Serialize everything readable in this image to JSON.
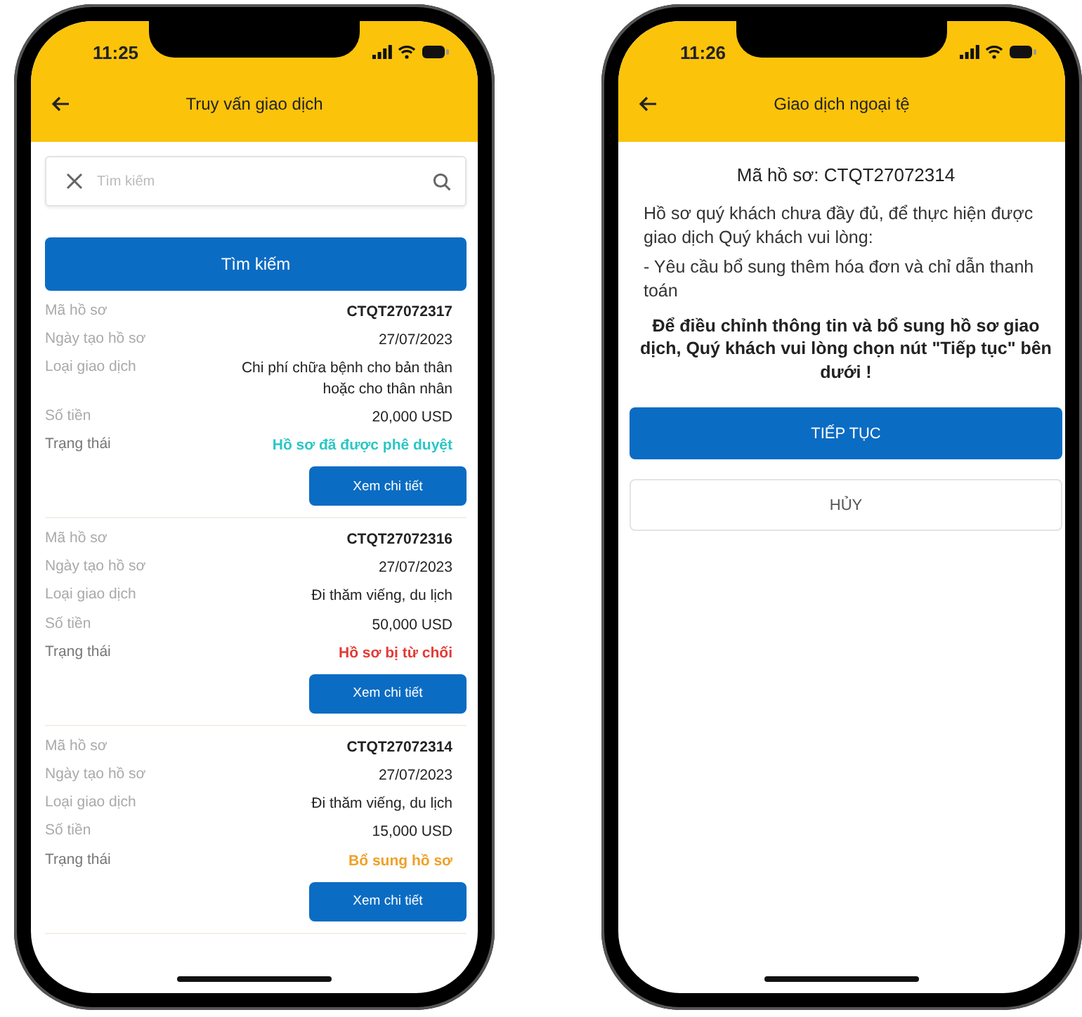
{
  "phones": [
    {
      "time": "11:25",
      "title": "Truy vấn giao dịch",
      "kind": "list",
      "search": {
        "placeholder": "Tìm kiếm"
      },
      "search_button": "Tìm kiếm",
      "records": [
        {
          "fields": [
            {
              "kind": "code",
              "label": "Mã hồ sơ",
              "value": "CTQT27072317"
            },
            {
              "kind": "plain",
              "label": "Ngày tạo hồ sơ",
              "value": "27/07/2023"
            },
            {
              "kind": "plain",
              "label": "Loại giao dịch",
              "value": "Chi phí chữa bệnh cho bản thân hoặc cho thân nhân"
            },
            {
              "kind": "plain",
              "label": "Số tiền",
              "value": "20,000 USD"
            },
            {
              "kind": "status",
              "label": "Trạng thái",
              "value": "Hồ sơ đã được phê duyệt",
              "color": "#2cc6c6"
            }
          ],
          "button": "Xem chi tiết"
        },
        {
          "fields": [
            {
              "kind": "code",
              "label": "Mã hồ sơ",
              "value": "CTQT27072316"
            },
            {
              "kind": "plain",
              "label": "Ngày tạo hồ sơ",
              "value": "27/07/2023"
            },
            {
              "kind": "plain",
              "label": "Loại giao dịch",
              "value": "Đi thăm viếng, du lịch"
            },
            {
              "kind": "plain",
              "label": "Số tiền",
              "value": "50,000 USD"
            },
            {
              "kind": "status",
              "label": "Trạng thái",
              "value": "Hồ sơ bị từ chối",
              "color": "#e53935"
            }
          ],
          "button": "Xem chi tiết"
        },
        {
          "fields": [
            {
              "kind": "code",
              "label": "Mã hồ sơ",
              "value": "CTQT27072314"
            },
            {
              "kind": "plain",
              "label": "Ngày tạo hồ sơ",
              "value": "27/07/2023"
            },
            {
              "kind": "plain",
              "label": "Loại giao dịch",
              "value": "Đi thăm viếng, du lịch"
            },
            {
              "kind": "plain",
              "label": "Số tiền",
              "value": "15,000 USD"
            },
            {
              "kind": "status",
              "label": "Trạng thái",
              "value": "Bổ sung hồ sơ",
              "color": "#f0a028"
            }
          ],
          "button": "Xem chi tiết"
        }
      ]
    },
    {
      "time": "11:26",
      "title": "Giao dịch ngoại tệ",
      "kind": "notice",
      "heading": "Mã hồ sơ: CTQT27072314",
      "paragraphs": [
        "Hồ sơ quý khách chưa đầy đủ, để thực hiện được giao dịch Quý khách vui lòng:",
        "- Yêu cầu bổ sung thêm hóa đơn và chỉ dẫn thanh toán"
      ],
      "instruction": "Để điều chỉnh thông tin và bổ sung hồ sơ giao dịch, Quý khách vui lòng chọn nút \"Tiếp tục\" bên dưới !",
      "buttons": [
        {
          "kind": "primary",
          "label": "TIẾP TỤC"
        },
        {
          "kind": "secondary",
          "label": "HỦY"
        }
      ]
    }
  ]
}
